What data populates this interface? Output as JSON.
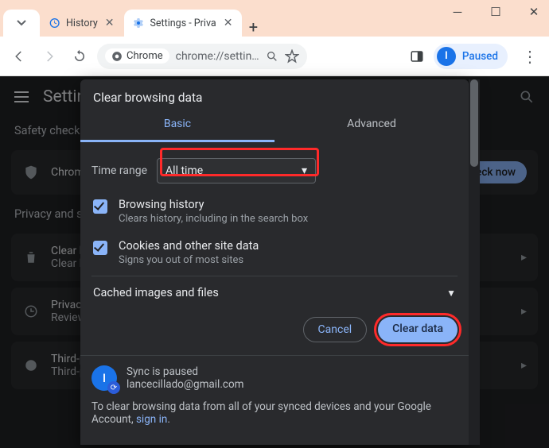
{
  "tabs": {
    "history": "History",
    "settings": "Settings - Priva"
  },
  "toolbar": {
    "chip": "Chrome",
    "url": "chrome://settin…",
    "paused": "Paused"
  },
  "page": {
    "title": "Settings",
    "safety_heading": "Safety check",
    "safety_item": "Chrome can help keep you safe",
    "check_now": "Check now",
    "privacy_heading": "Privacy and security",
    "rows": {
      "clear_t": "Clear browsing data",
      "clear_s": "Clear history, cookies, cache, and more",
      "guide_t": "Privacy Guide",
      "guide_s": "Review key privacy and security controls",
      "cookies_t": "Third-party cookies",
      "cookies_s": "Third-party cookies are blocked"
    }
  },
  "dialog": {
    "title": "Clear browsing data",
    "tab_basic": "Basic",
    "tab_advanced": "Advanced",
    "time_label": "Time range",
    "time_value": "All time",
    "o1_t": "Browsing history",
    "o1_s": "Clears history, including in the search box",
    "o2_t": "Cookies and other site data",
    "o2_s": "Signs you out of most sites",
    "o3_t": "Cached images and files",
    "cancel": "Cancel",
    "clear": "Clear data",
    "sync_t": "Sync is paused",
    "sync_email": "lancecillado@gmail.com",
    "foot1": "To clear browsing data from all of your synced devices and your Google Account, ",
    "foot_link": "sign in"
  }
}
